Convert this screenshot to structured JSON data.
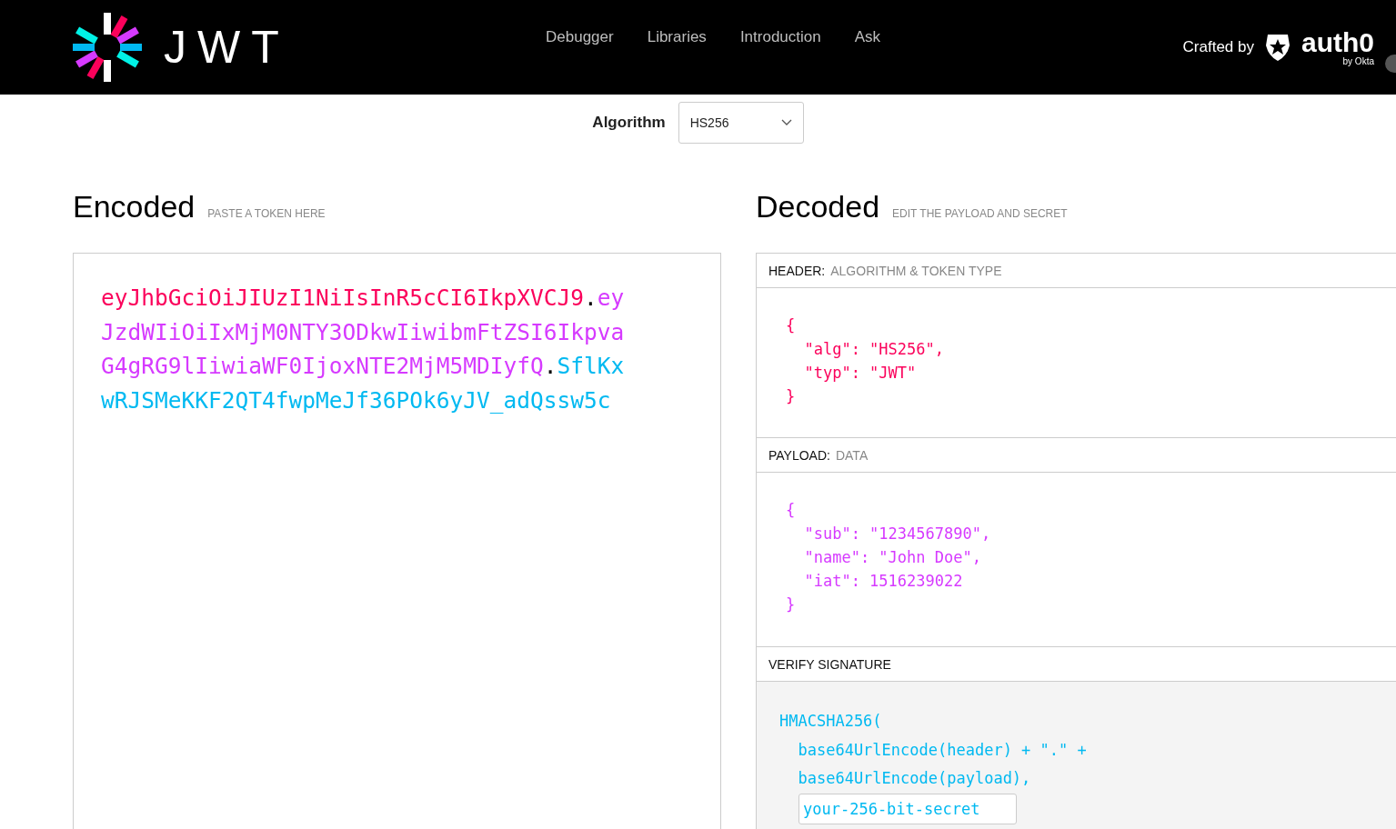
{
  "nav": {
    "logo_text": "JWT",
    "links": [
      "Debugger",
      "Libraries",
      "Introduction",
      "Ask"
    ],
    "crafted_by": "Crafted by",
    "brand": "auth0",
    "brand_sub": "by Okta"
  },
  "algorithm": {
    "label": "Algorithm",
    "value": "HS256"
  },
  "encoded": {
    "title": "Encoded",
    "hint": "PASTE A TOKEN HERE",
    "token": [
      {
        "kind": "header",
        "text": "eyJhbGciOiJIUzI1NiIsInR5cCI6IkpXVCJ9"
      },
      {
        "kind": "dot",
        "text": "."
      },
      {
        "kind": "payload",
        "text": "eyJzdWIiOiIxMjM0NTY3ODkwIiwibmFtZSI6IkpvaG4gRG9lIiwiaWF0IjoxNTE2MjM5MDIyfQ"
      },
      {
        "kind": "dot",
        "text": "."
      },
      {
        "kind": "signature",
        "text": "SflKxwRJSMeKKF2QT4fwpMeJf36POk6yJV_adQssw5c"
      }
    ]
  },
  "decoded": {
    "title": "Decoded",
    "hint": "EDIT THE PAYLOAD AND SECRET",
    "sections": [
      {
        "kind": "header",
        "label": "HEADER:",
        "sublabel": "ALGORITHM & TOKEN TYPE",
        "lines": [
          "{",
          "  \"alg\": \"HS256\",",
          "  \"typ\": \"JWT\"",
          "}"
        ]
      },
      {
        "kind": "payload",
        "label": "PAYLOAD:",
        "sublabel": "DATA",
        "lines": [
          "{",
          "  \"sub\": \"1234567890\",",
          "  \"name\": \"John Doe\",",
          "  \"iat\": 1516239022",
          "}"
        ]
      },
      {
        "kind": "signature",
        "label": "VERIFY SIGNATURE",
        "lines": [
          "HMACSHA256(",
          "  base64UrlEncode(header) + \".\" +",
          "  base64UrlEncode(payload),"
        ],
        "secret": "your-256-bit-secret"
      }
    ]
  }
}
